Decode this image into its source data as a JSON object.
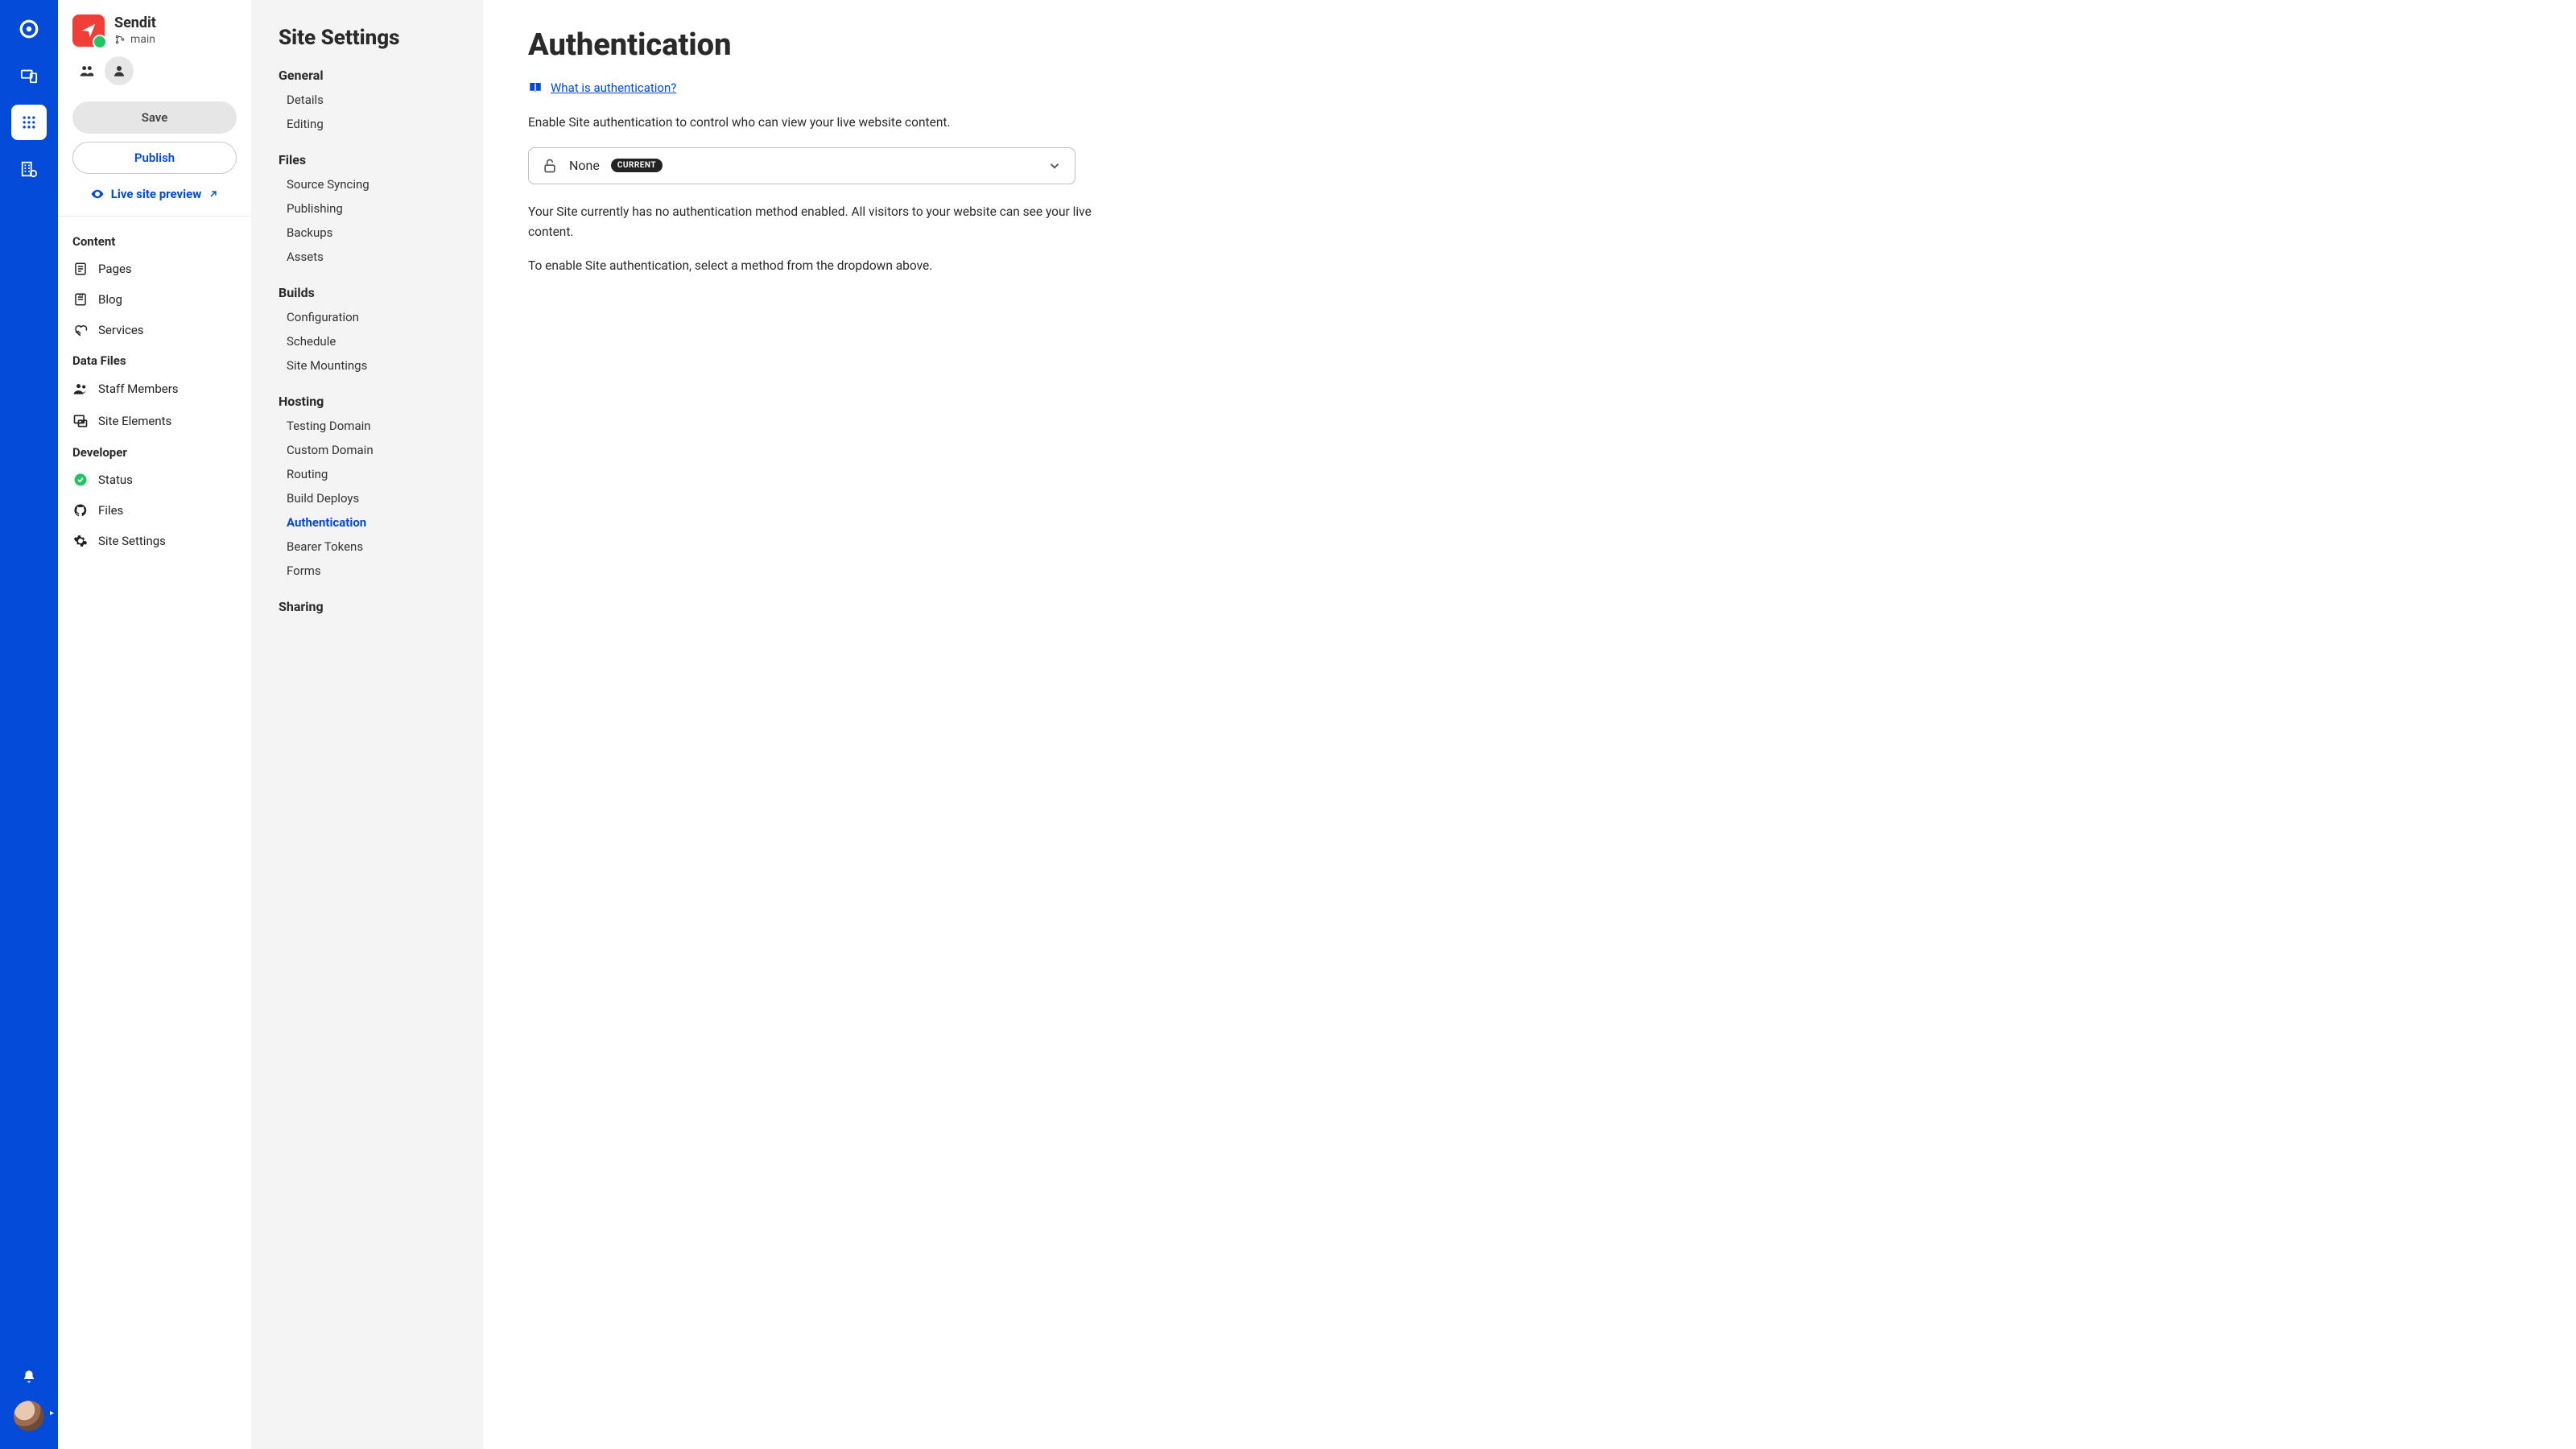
{
  "site": {
    "name": "Sendit",
    "branch": "main"
  },
  "actions": {
    "save": "Save",
    "publish": "Publish",
    "live_preview": "Live site preview"
  },
  "sidebar": {
    "groups": [
      {
        "label": "Content",
        "items": [
          {
            "icon": "page-icon",
            "label": "Pages"
          },
          {
            "icon": "blog-icon",
            "label": "Blog"
          },
          {
            "icon": "services-icon",
            "label": "Services"
          }
        ]
      },
      {
        "label": "Data Files",
        "items": [
          {
            "icon": "staff-icon",
            "label": "Staff Members"
          },
          {
            "icon": "elements-icon",
            "label": "Site Elements"
          }
        ]
      },
      {
        "label": "Developer",
        "items": [
          {
            "icon": "status-icon",
            "label": "Status"
          },
          {
            "icon": "github-icon",
            "label": "Files"
          },
          {
            "icon": "gear-icon",
            "label": "Site Settings"
          }
        ]
      }
    ]
  },
  "settings_panel": {
    "title": "Site Settings",
    "groups": [
      {
        "label": "General",
        "items": [
          "Details",
          "Editing"
        ]
      },
      {
        "label": "Files",
        "items": [
          "Source Syncing",
          "Publishing",
          "Backups",
          "Assets"
        ]
      },
      {
        "label": "Builds",
        "items": [
          "Configuration",
          "Schedule",
          "Site Mountings"
        ]
      },
      {
        "label": "Hosting",
        "items": [
          "Testing Domain",
          "Custom Domain",
          "Routing",
          "Build Deploys",
          "Authentication",
          "Bearer Tokens",
          "Forms"
        ]
      },
      {
        "label": "Sharing",
        "items": []
      }
    ],
    "active": "Authentication"
  },
  "main": {
    "heading": "Authentication",
    "help_link": "What is authentication?",
    "intro": "Enable Site authentication to control who can view your live website content.",
    "dropdown": {
      "value": "None",
      "badge": "CURRENT"
    },
    "body1": "Your Site currently has no authentication method enabled. All visitors to your website can see your live content.",
    "body2": "To enable Site authentication, select a method from the dropdown above."
  }
}
